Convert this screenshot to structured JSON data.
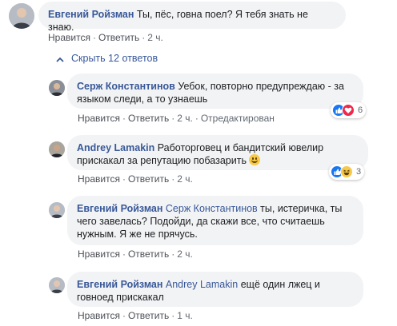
{
  "colors": {
    "link": "#385898",
    "bubble": "#f2f3f5",
    "meta": "#606770",
    "like": "#1877f2",
    "love": "#f0284a",
    "haha": "#f7c948"
  },
  "top_comment": {
    "author": "Евгений Ройзман",
    "text": "Ты, пёс, говна поел? Я тебя знать не знаю.",
    "actions": {
      "like": "Нравится",
      "reply": "Ответить",
      "time": "2 ч."
    }
  },
  "replies_toggle": {
    "label": "Скрыть 12 ответов"
  },
  "replies": [
    {
      "author": "Серж Константинов",
      "line1": "Уебок, повторно предупреждаю - за",
      "line2": "языком следи, а то узнаешь",
      "actions": {
        "like": "Нравится",
        "reply": "Ответить",
        "time": "2 ч.",
        "edited": "Отредактирован"
      },
      "reactions": {
        "icons": [
          "like-icon",
          "love-icon"
        ],
        "count": "6"
      }
    },
    {
      "author": "Andrey Lamakin",
      "line1": "Работорговец и бандитский ювелир",
      "line2": "прискакал за репутацию побазарить",
      "actions": {
        "like": "Нравится",
        "reply": "Ответить",
        "time": "2 ч."
      },
      "reactions": {
        "icons": [
          "like-icon",
          "haha-icon"
        ],
        "count": "3"
      }
    },
    {
      "author": "Евгений Ройзман",
      "mention": "Серж Константинов",
      "line1_rest": "ты, истеричка, ты",
      "line2": "чего завелась? Подойди, да скажи все, что считаешь",
      "line3": "нужным. Я же не прячусь.",
      "actions": {
        "like": "Нравится",
        "reply": "Ответить",
        "time": "2 ч."
      }
    },
    {
      "author": "Евгений Ройзман",
      "mention": "Andrey Lamakin",
      "line1_rest": "ещё один лжец и",
      "line2": "говноед прискакал",
      "actions": {
        "like": "Нравится",
        "reply": "Ответить",
        "time": "1 ч."
      }
    }
  ]
}
